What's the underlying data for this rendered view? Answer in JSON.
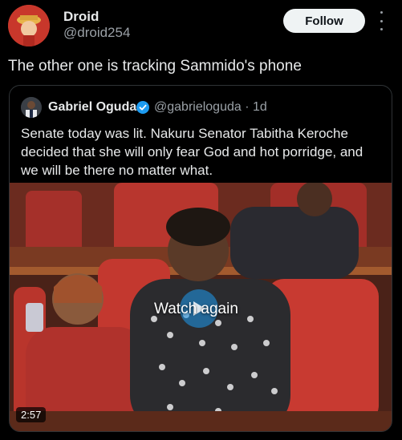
{
  "author": {
    "name": "Droid",
    "handle": "@droid254"
  },
  "actions": {
    "follow_label": "Follow",
    "more_icon": "more-vertical-icon"
  },
  "tweet": {
    "text": "The other one is tracking Sammido's phone"
  },
  "quoted": {
    "name": "Gabriel Oguda",
    "handle_time": "@gabrieloguda · 1d",
    "verified_icon": "verified-badge-icon",
    "text": "Senate today was lit. Nakuru Senator Tabitha Keroche decided that she will only fear God and hot porridge, and we will be there no matter what.",
    "media": {
      "overlay_label": "Watch again",
      "play_icon": "play-icon",
      "duration": "2:57"
    }
  },
  "colors": {
    "background": "#000000",
    "verified": "#1d9bf0",
    "follow_bg": "#eff3f4"
  }
}
